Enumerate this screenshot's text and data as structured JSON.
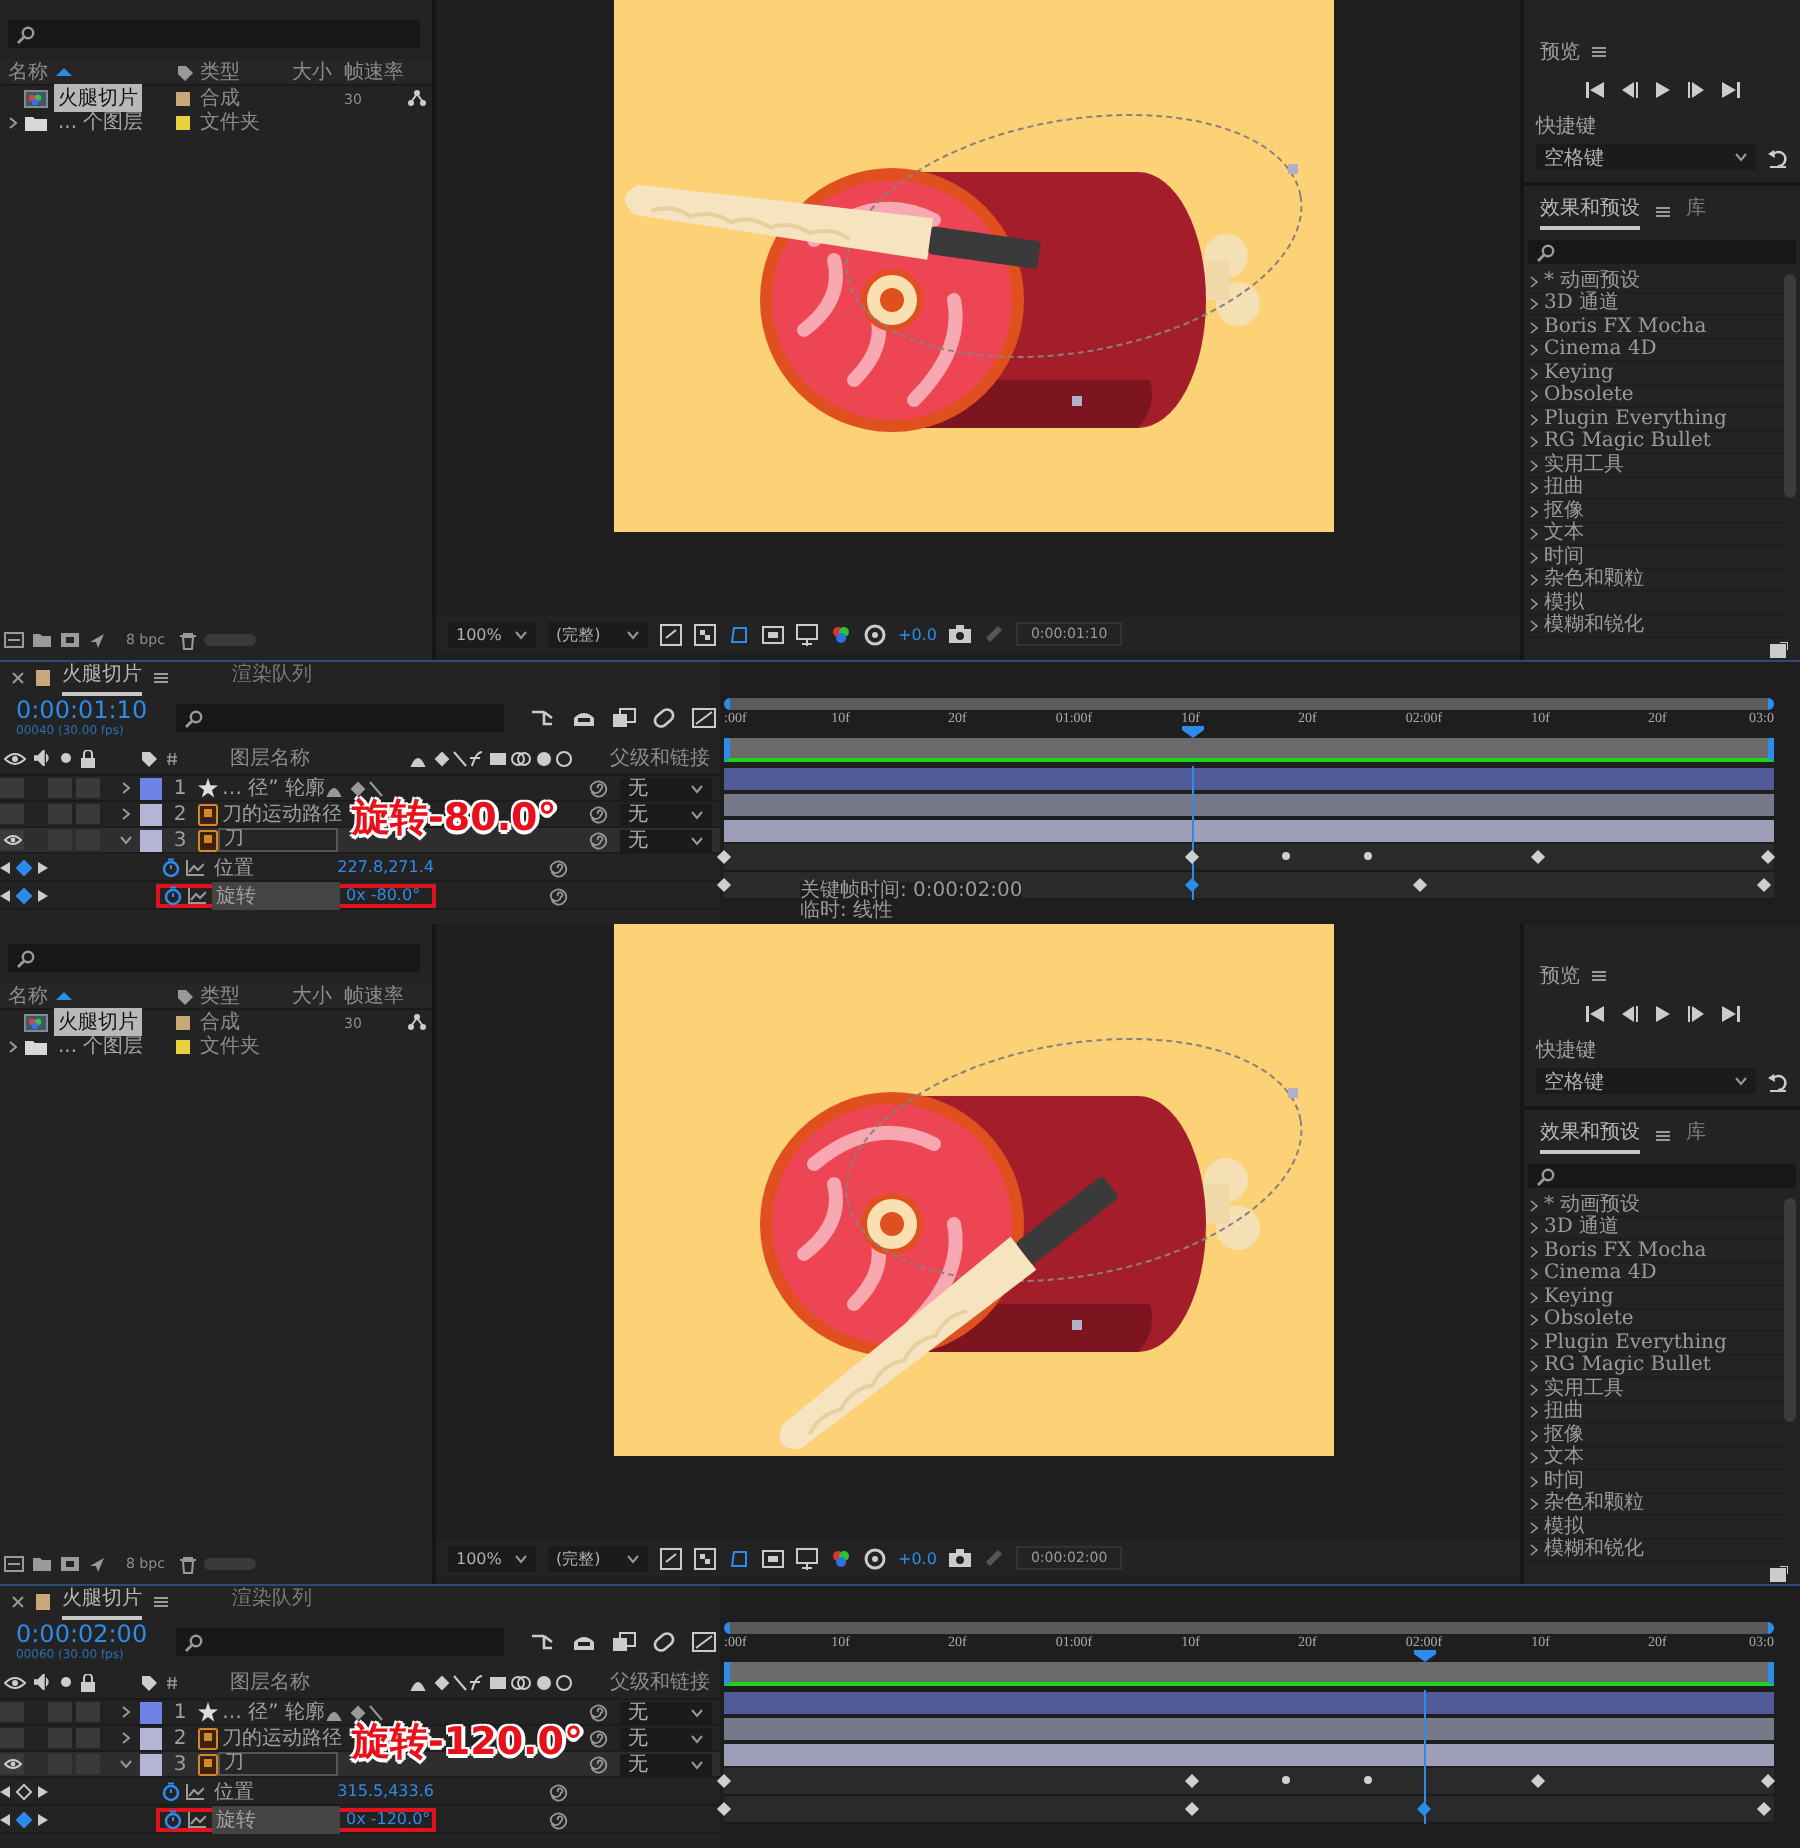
{
  "screens": [
    {
      "project": {
        "columns": [
          "名称",
          "类型",
          "大小",
          "帧速率"
        ],
        "items": [
          {
            "name": "火腿切片",
            "kind": "composition",
            "type": "合成",
            "fps": "30",
            "color": "#c8a878",
            "selected": true
          },
          {
            "name": "... 个图层",
            "kind": "folder",
            "type": "文件夹",
            "color": "#e8d040",
            "selected": false,
            "expanded": false
          }
        ],
        "bpc": "8 bpc"
      },
      "viewer": {
        "knife": {
          "kind": "raised"
        },
        "zoom": "100%",
        "resolution": "(完整)",
        "exposure": "+0.0",
        "timecode": "0:00:01:10"
      },
      "preview": {
        "title": "预览",
        "shortcut_label": "快捷键",
        "shortcut": "空格键"
      },
      "effects": {
        "tabs": [
          {
            "label": "效果和预设",
            "selected": true
          },
          {
            "label": "库",
            "selected": false
          }
        ],
        "items": [
          "* 动画预设",
          "3D 通道",
          "Boris FX Mocha",
          "Cinema 4D",
          "Keying",
          "Obsolete",
          "Plugin Everything",
          "RG Magic Bullet",
          "实用工具",
          "扭曲",
          "抠像",
          "文本",
          "时间",
          "杂色和颗粒",
          "模拟",
          "模糊和锐化"
        ]
      },
      "timeline": {
        "tabs": [
          {
            "label": "火腿切片",
            "selected": true
          },
          {
            "label": "渲染队列",
            "selected": false
          }
        ],
        "time": "0:00:01:10",
        "frames": "00040 (30.00 fps)",
        "layer_header": "图层名称",
        "parent_header": "父级和链接",
        "layers": [
          {
            "number": "1",
            "name": "… 径” 轮廓",
            "kind": "shape",
            "color": "#6f82e6",
            "parent": "无",
            "visible": false,
            "expanded": false,
            "selected": false
          },
          {
            "number": "2",
            "name": "刀的运动路径",
            "kind": "precomp",
            "color": "#b4b4d4",
            "parent": "无",
            "visible": false,
            "expanded": false,
            "selected": false
          },
          {
            "number": "3",
            "name": "刀",
            "kind": "precomp",
            "color": "#b4b4d4",
            "parent": "无",
            "visible": true,
            "expanded": true,
            "selected": true
          }
        ],
        "properties": [
          {
            "name": "位置",
            "value": "227.8,271.4",
            "at_keyframe": true,
            "highlighted": false,
            "keyframes": [
              {
                "level": 0,
                "kind": "linear",
                "selected": false
              },
              {
                "level": 0.446,
                "kind": "linear",
                "selected": false
              },
              {
                "level": 0.535,
                "kind": "roving",
                "selected": false
              },
              {
                "level": 0.613,
                "kind": "roving",
                "selected": false
              },
              {
                "level": 0.775,
                "kind": "linear",
                "selected": false
              },
              {
                "level": 0.995,
                "kind": "linear",
                "selected": false
              }
            ]
          },
          {
            "name": "旋转",
            "value": "0x -80.0°",
            "at_keyframe": true,
            "highlighted": true,
            "keyframes": [
              {
                "level": 0,
                "kind": "linear",
                "selected": false
              },
              {
                "level": 0.446,
                "kind": "linear",
                "selected": true
              },
              {
                "level": 0.663,
                "kind": "linear",
                "selected": false
              },
              {
                "level": 0.99,
                "kind": "linear",
                "selected": false
              }
            ]
          }
        ],
        "ruler": [
          ":00f",
          "10f",
          "20f",
          "01:00f",
          "10f",
          "20f",
          "02:00f",
          "10f",
          "20f",
          "03:0"
        ],
        "playhead": {
          "level": 0.446
        },
        "annotation": "旋转-80.0°",
        "tooltip": [
          "关键帧时间: 0:00:02:00",
          "临时: 线性"
        ]
      }
    },
    {
      "project": {
        "columns": [
          "名称",
          "类型",
          "大小",
          "帧速率"
        ],
        "items": [
          {
            "name": "火腿切片",
            "kind": "composition",
            "type": "合成",
            "fps": "30",
            "color": "#c8a878",
            "selected": true
          },
          {
            "name": "... 个图层",
            "kind": "folder",
            "type": "文件夹",
            "color": "#e8d040",
            "selected": false,
            "expanded": false
          }
        ],
        "bpc": "8 bpc"
      },
      "viewer": {
        "knife": {
          "kind": "lowered"
        },
        "zoom": "100%",
        "resolution": "(完整)",
        "exposure": "+0.0",
        "timecode": "0:00:02:00"
      },
      "preview": {
        "title": "预览",
        "shortcut_label": "快捷键",
        "shortcut": "空格键"
      },
      "effects": {
        "tabs": [
          {
            "label": "效果和预设",
            "selected": true
          },
          {
            "label": "库",
            "selected": false
          }
        ],
        "items": [
          "* 动画预设",
          "3D 通道",
          "Boris FX Mocha",
          "Cinema 4D",
          "Keying",
          "Obsolete",
          "Plugin Everything",
          "RG Magic Bullet",
          "实用工具",
          "扭曲",
          "抠像",
          "文本",
          "时间",
          "杂色和颗粒",
          "模拟",
          "模糊和锐化"
        ]
      },
      "timeline": {
        "tabs": [
          {
            "label": "火腿切片",
            "selected": true
          },
          {
            "label": "渲染队列",
            "selected": false
          }
        ],
        "time": "0:00:02:00",
        "frames": "00060 (30.00 fps)",
        "layer_header": "图层名称",
        "parent_header": "父级和链接",
        "layers": [
          {
            "number": "1",
            "name": "… 径” 轮廓",
            "kind": "shape",
            "color": "#6f82e6",
            "parent": "无",
            "visible": false,
            "expanded": false,
            "selected": false
          },
          {
            "number": "2",
            "name": "刀的运动路径",
            "kind": "precomp",
            "color": "#b4b4d4",
            "parent": "无",
            "visible": false,
            "expanded": false,
            "selected": false
          },
          {
            "number": "3",
            "name": "刀",
            "kind": "precomp",
            "color": "#b4b4d4",
            "parent": "无",
            "visible": true,
            "expanded": true,
            "selected": true
          }
        ],
        "properties": [
          {
            "name": "位置",
            "value": "315.5,433.6",
            "at_keyframe": false,
            "highlighted": false,
            "keyframes": [
              {
                "level": 0,
                "kind": "linear",
                "selected": false
              },
              {
                "level": 0.446,
                "kind": "linear",
                "selected": false
              },
              {
                "level": 0.535,
                "kind": "roving",
                "selected": false
              },
              {
                "level": 0.613,
                "kind": "roving",
                "selected": false
              },
              {
                "level": 0.775,
                "kind": "linear",
                "selected": false
              },
              {
                "level": 0.995,
                "kind": "linear",
                "selected": false
              }
            ]
          },
          {
            "name": "旋转",
            "value": "0x -120.0°",
            "at_keyframe": true,
            "highlighted": true,
            "keyframes": [
              {
                "level": 0,
                "kind": "linear",
                "selected": false
              },
              {
                "level": 0.446,
                "kind": "linear",
                "selected": false
              },
              {
                "level": 0.667,
                "kind": "linear",
                "selected": true
              },
              {
                "level": 0.99,
                "kind": "linear",
                "selected": false
              }
            ]
          }
        ],
        "ruler": [
          ":00f",
          "10f",
          "20f",
          "01:00f",
          "10f",
          "20f",
          "02:00f",
          "10f",
          "20f",
          "03:0"
        ],
        "playhead": {
          "level": 0.667
        },
        "annotation": "旋转-120.0°"
      }
    }
  ]
}
